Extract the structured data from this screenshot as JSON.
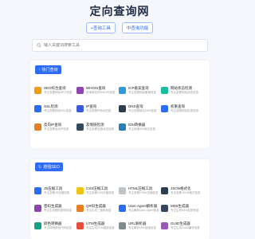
{
  "header": {
    "title": "定向查询网",
    "links": [
      "+查询工具",
      "中查询功能"
    ]
  },
  "search": {
    "placeholder": "输入关键词搜索工具"
  },
  "sections": [
    {
      "title": "热门查询",
      "items": [
        {
          "title": "SEO综合查询",
          "desc": "专注查看网站SEO信息",
          "icon": "chart-icon",
          "color": "#f39c12"
        },
        {
          "title": "WHOIS查询",
          "desc": "查询域名的WHOIS信息",
          "icon": "globe-icon",
          "color": "#8e44ad"
        },
        {
          "title": "ICP备案查询",
          "desc": "专注查看网站备案信息",
          "icon": "shield-icon",
          "color": "#3498db"
        },
        {
          "title": "网站状态检测",
          "desc": "专注查看网站状态信息",
          "icon": "status-icon",
          "color": "#1abc9c"
        },
        {
          "title": "SSL检测",
          "desc": "专注查看网站SSL信息",
          "icon": "lock-icon",
          "color": "#2d6cf6"
        },
        {
          "title": "IP查询",
          "desc": "专注查看IP地址信息",
          "icon": "ip-icon",
          "color": "#3b5bdb"
        },
        {
          "title": "DNS查询",
          "desc": "专注查看域名DNS信息",
          "icon": "dns-icon",
          "color": "#2c3e50"
        },
        {
          "title": "权重查询",
          "desc": "专注查看网站权重信息",
          "icon": "weight-icon",
          "color": "#2d6cf6"
        },
        {
          "title": "反向IP查询",
          "desc": "专注查看反向IP信息",
          "icon": "reverse-icon",
          "color": "#e67e22"
        },
        {
          "title": "友情链检测",
          "desc": "专注查看友链状态信息",
          "icon": "link-icon",
          "color": "#34495e"
        },
        {
          "title": "IDN转换器",
          "desc": "专注转换IDN域名信息",
          "icon": "convert-icon",
          "color": "#2980b9"
        }
      ]
    },
    {
      "title": "增强SEO",
      "items": [
        {
          "title": "JS压缩工具",
          "desc": "专注查看JS压缩信息",
          "icon": "js-icon",
          "color": "#2d6cf6"
        },
        {
          "title": "CSS压缩工具",
          "desc": "专注查看CSS压缩信息",
          "icon": "css-icon",
          "color": "#f1c40f"
        },
        {
          "title": "HTML压缩工具",
          "desc": "专注查看HTML压缩信息",
          "icon": "html-icon",
          "color": "#bdc3c7"
        },
        {
          "title": "JSON格式化",
          "desc": "专注查看JSON格式信息",
          "icon": "json-icon",
          "color": "#2c3e50"
        },
        {
          "title": "密码生成器",
          "desc": "专注生成随机密码信息",
          "icon": "key-icon",
          "color": "#8e44ad"
        },
        {
          "title": "QR码生成器",
          "desc": "专注生成二维码信息",
          "icon": "qr-icon",
          "color": "#e67e22"
        },
        {
          "title": "User-Agent解析器",
          "desc": "专注解析User-Agent信息",
          "icon": "ua-icon",
          "color": "#2d6cf6"
        },
        {
          "title": "MD5生成器",
          "desc": "专注生成MD5加密信息",
          "icon": "md5-icon",
          "color": "#34495e"
        },
        {
          "title": "颜色转换器",
          "desc": "专注转换颜色代码信息",
          "icon": "palette-icon",
          "color": "#16a085"
        },
        {
          "title": "UTM生成器",
          "desc": "专注生成UTM链接信息",
          "icon": "utm-icon",
          "color": "#e74c3c"
        },
        {
          "title": "URL解析器",
          "desc": "专注解析URL链接信息",
          "icon": "url-icon",
          "color": "#7f8c8d"
        },
        {
          "title": "GUID生成器",
          "desc": "专注生成GUID编号信息",
          "icon": "guid-icon",
          "color": "#9b59b6"
        }
      ]
    }
  ]
}
